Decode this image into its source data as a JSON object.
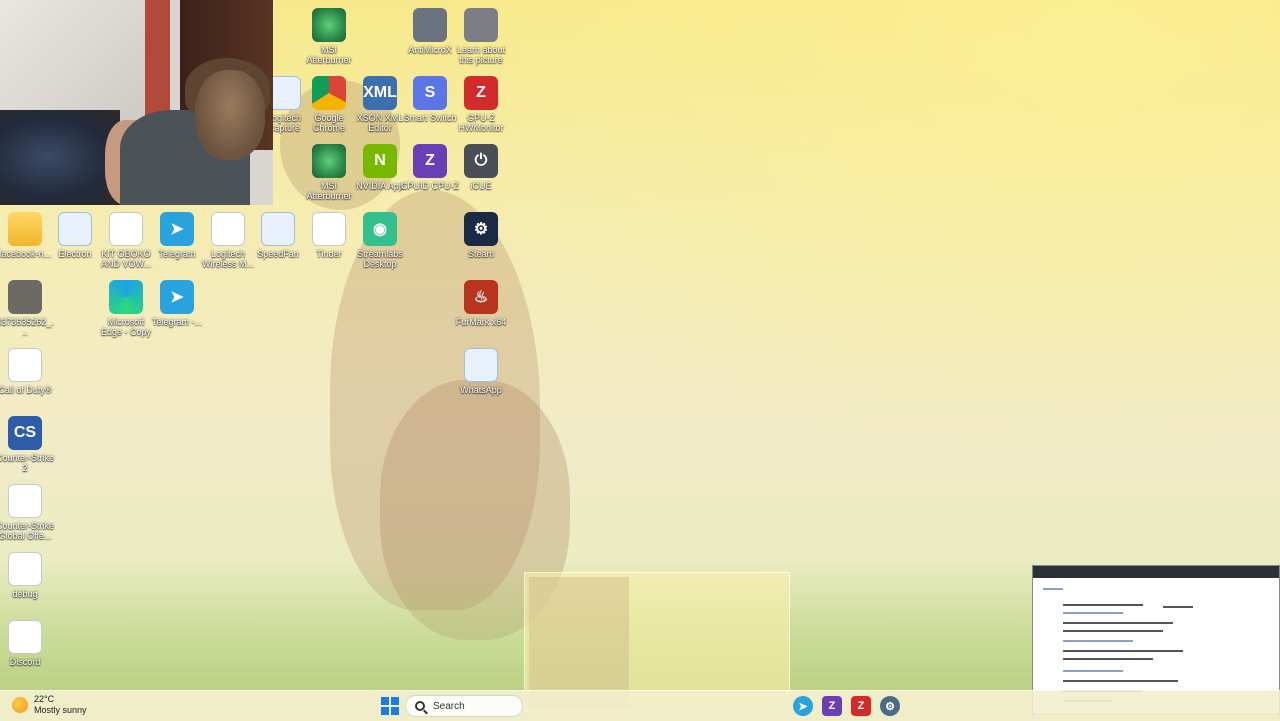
{
  "desktop_icons": [
    {
      "label": "MSI Afterburner",
      "glyph": "",
      "icon": "msi-afterburner-icon",
      "cls": "g-msi"
    },
    {
      "label": "AntiMicroX",
      "glyph": "",
      "icon": "gamepad-icon",
      "cls": "g-xbox"
    },
    {
      "label": "Learn about this picture",
      "glyph": "",
      "icon": "learn-picture-icon",
      "cls": "g-learn"
    },
    {
      "label": "Logitech Capture",
      "glyph": "",
      "icon": "document-icon",
      "cls": "g-docblue"
    },
    {
      "label": "Google Chrome",
      "glyph": "",
      "icon": "chrome-icon",
      "cls": "g-chrome"
    },
    {
      "label": "XSON XML Editor",
      "glyph": "XML",
      "icon": "xml-editor-icon",
      "cls": "g-xml"
    },
    {
      "label": "Smart Switch",
      "glyph": "S",
      "icon": "smart-switch-icon",
      "cls": "g-smart"
    },
    {
      "label": "GPU-Z HWMonitor",
      "glyph": "Z",
      "icon": "gpuz-icon",
      "cls": "g-gpuz"
    },
    {
      "label": "MSI Afterburner",
      "glyph": "",
      "icon": "msi-afterburner-icon",
      "cls": "g-msi"
    },
    {
      "label": "NVIDIA App",
      "glyph": "N",
      "icon": "nvidia-icon",
      "cls": "g-nvidia"
    },
    {
      "label": "CPUID CPU-Z",
      "glyph": "Z",
      "icon": "cpuz-icon",
      "cls": "g-cpuz"
    },
    {
      "label": "iCUE",
      "glyph": "⏻",
      "icon": "icue-icon",
      "cls": "g-icue"
    },
    {
      "label": "facebook-n...",
      "glyph": "",
      "icon": "folder-icon",
      "cls": "g-folder"
    },
    {
      "label": "Electron",
      "glyph": "",
      "icon": "document-icon",
      "cls": "g-docblue"
    },
    {
      "label": "KIT OBOKO AND VOW...",
      "glyph": "",
      "icon": "document-icon",
      "cls": "g-doc"
    },
    {
      "label": "Telegram",
      "glyph": "➤",
      "icon": "telegram-icon",
      "cls": "g-telegram"
    },
    {
      "label": "Logitech Wireless M...",
      "glyph": "",
      "icon": "document-icon",
      "cls": "g-doc"
    },
    {
      "label": "SpeedFan",
      "glyph": "",
      "icon": "document-icon",
      "cls": "g-docblue"
    },
    {
      "label": "Tinder",
      "glyph": "",
      "icon": "document-icon",
      "cls": "g-doc"
    },
    {
      "label": "Streamlabs Desktop",
      "glyph": "◉",
      "icon": "streamlabs-icon",
      "cls": "g-stream"
    },
    {
      "label": "Steam",
      "glyph": "⚙",
      "icon": "steam-icon",
      "cls": "g-steam"
    },
    {
      "label": "4373635262_...",
      "glyph": "",
      "icon": "image-file-icon",
      "cls": "g-img"
    },
    {
      "label": "Microsoft Edge - Copy",
      "glyph": "",
      "icon": "edge-icon",
      "cls": "g-edge"
    },
    {
      "label": "Telegram -...",
      "glyph": "➤",
      "icon": "telegram-icon",
      "cls": "g-telegram"
    },
    {
      "label": "FurMark x64",
      "glyph": "♨",
      "icon": "furmark-icon",
      "cls": "g-fur"
    },
    {
      "label": "Call of Duty®",
      "glyph": "",
      "icon": "document-icon",
      "cls": "g-doc"
    },
    {
      "label": "WhatsApp",
      "glyph": "",
      "icon": "whatsapp-icon",
      "cls": "g-docblue"
    },
    {
      "label": "Counter-Strike 2",
      "glyph": "CS",
      "icon": "counter-strike-icon",
      "cls": "g-cs"
    },
    {
      "label": "Counter-Strike Global Offe...",
      "glyph": "",
      "icon": "document-icon",
      "cls": "g-doc"
    },
    {
      "label": "debug",
      "glyph": "",
      "icon": "document-icon",
      "cls": "g-doc"
    },
    {
      "label": "Discord",
      "glyph": "",
      "icon": "document-icon",
      "cls": "g-doc"
    }
  ],
  "taskbar": {
    "weather_temp": "22°C",
    "weather_desc": "Mostly sunny",
    "search_label": "Search",
    "apps": [
      {
        "icon": "telegram-taskbar-icon",
        "glyph": "➤",
        "color": "#29a3dd"
      },
      {
        "icon": "cpuz-taskbar-icon",
        "glyph": "Z",
        "color": "#6a3fb5"
      },
      {
        "icon": "gpuz-taskbar-icon",
        "glyph": "Z",
        "color": "#d22b2b"
      },
      {
        "icon": "settings-gear-icon",
        "glyph": "⚙",
        "color": "#4a6b8a"
      }
    ]
  }
}
